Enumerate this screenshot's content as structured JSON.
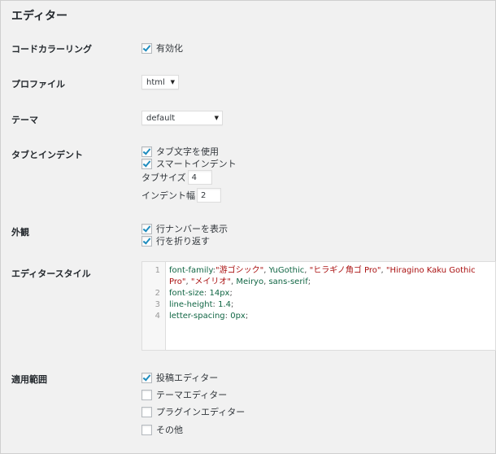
{
  "title": "エディター",
  "sections": {
    "code_coloring": {
      "label": "コードカラーリング",
      "option": "有効化"
    },
    "profile": {
      "label": "プロファイル",
      "value": "html"
    },
    "theme": {
      "label": "テーマ",
      "value": "default"
    },
    "tabs": {
      "label": "タブとインデント",
      "use_tab": "タブ文字を使用",
      "smart_indent": "スマートインデント",
      "tab_size_label": "タブサイズ",
      "tab_size_value": "4",
      "indent_width_label": "インデント幅",
      "indent_width_value": "2"
    },
    "appearance": {
      "label": "外観",
      "line_numbers": "行ナンバーを表示",
      "wrap": "行を折り返す"
    },
    "editor_style": {
      "label": "エディタースタイル",
      "line_numbers": [
        "1",
        "2",
        "3",
        "4"
      ],
      "line1a": {
        "prop": "font-family",
        "s1": "\"游ゴシック\"",
        "t1": "YuGothic",
        "s2": "\"ヒラギノ角ゴ Pro\"",
        "s3": "\"Hiragino Kaku Gothic"
      },
      "line1b": {
        "s3b": "Pro\"",
        "s4": "\"メイリオ\"",
        "t2": "Meiryo",
        "t3": "sans-serif"
      },
      "line2": {
        "prop": "font-size",
        "val": "14px"
      },
      "line3": {
        "prop": "line-height",
        "val": "1.4"
      },
      "line4": {
        "prop": "letter-spacing",
        "val": "0px"
      }
    },
    "scope": {
      "label": "適用範囲",
      "post_editor": "投稿エディター",
      "theme_editor": "テーマエディター",
      "plugin_editor": "プラグインエディター",
      "other": "その他"
    }
  }
}
